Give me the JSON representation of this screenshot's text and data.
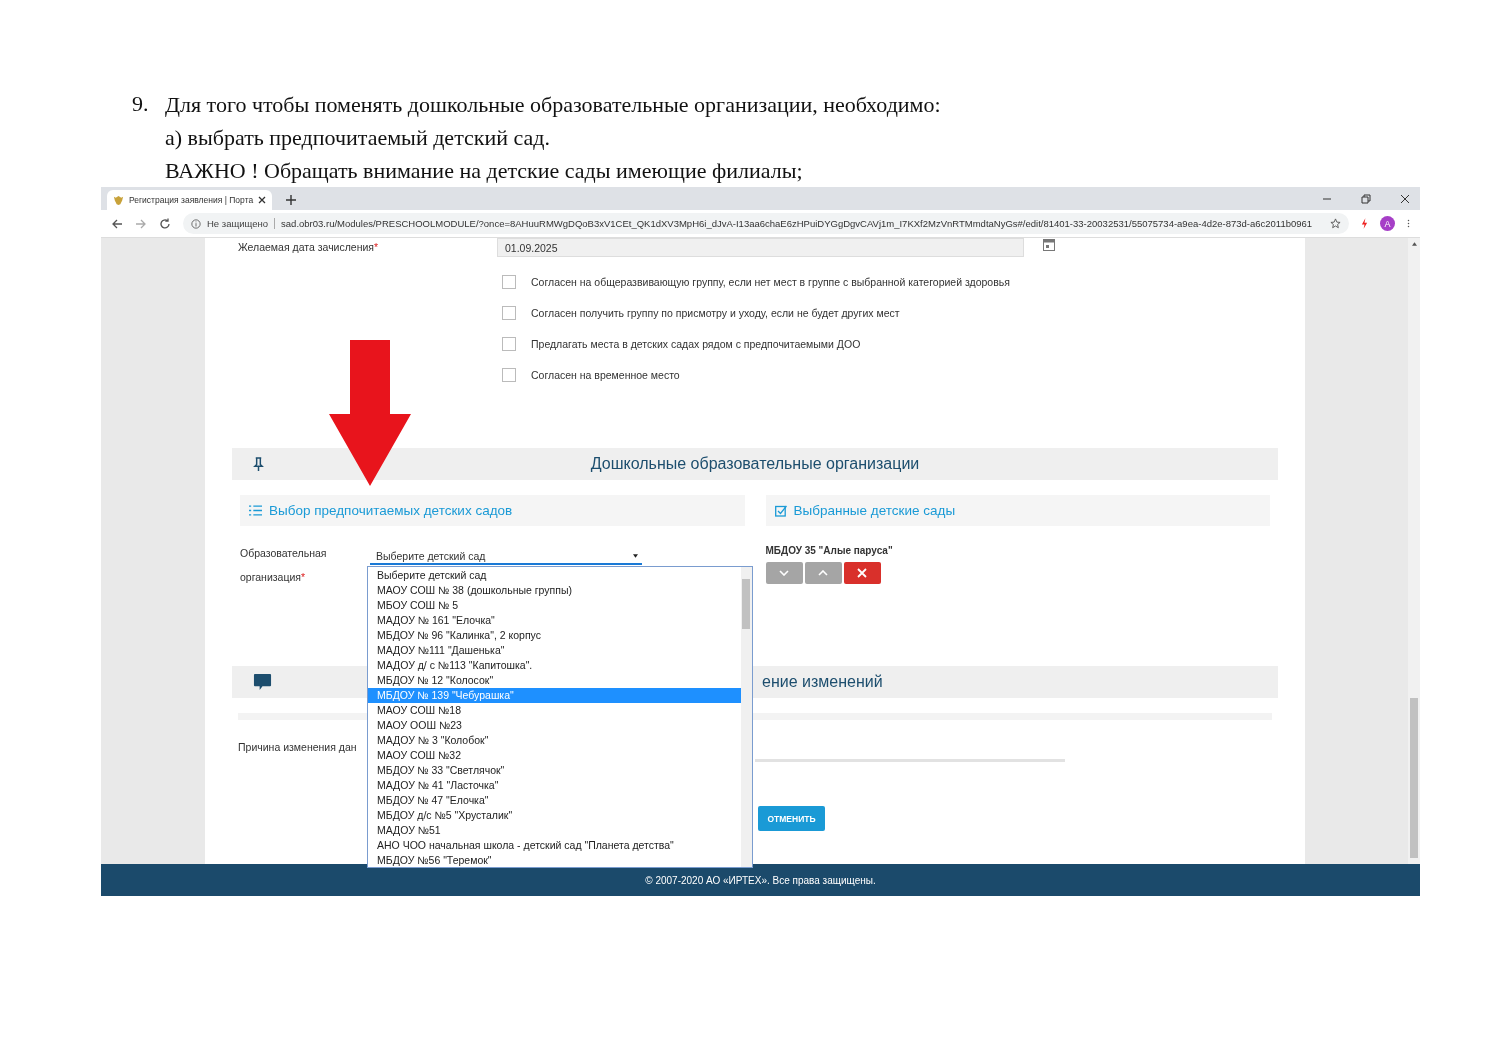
{
  "instructions": {
    "number": "9.",
    "lines": [
      "Для того чтобы поменять дошкольные образовательные организации, необходимо:",
      "а) выбрать предпочитаемый детский сад.",
      "ВАЖНО ! Обращать внимание на детские сады имеющие филиалы;"
    ]
  },
  "browser": {
    "tab_title": "Регистрация заявления | Порта",
    "security": "Не защищено",
    "url": "sad.obr03.ru/Modules/PRESCHOOLMODULE/?once=8AHuuRMWgDQoB3xV1CEt_QK1dXV3MpH6i_dJvA-I13aa6chaE6zHPuiDYGgDgvCAVj1m_I7KXf2MzVnRTMmdtaNyGs#/edit/81401-33-20032531/55075734-a9ea-4d2e-873d-a6c2011b0961",
    "profile_initial": "A"
  },
  "form": {
    "date_label": "Желаемая дата зачисления",
    "required_mark": "*",
    "date_value": "01.09.2025",
    "options": [
      {
        "label": "Согласен на общеразвивающую группу, если нет мест в группе с выбранной категорией здоровья",
        "checked": false
      },
      {
        "label": "Согласен получить группу по присмотру и уходу, если не будет других мест",
        "checked": false
      },
      {
        "label": "Предлагать места в детских садах рядом с предпочитаемыми ДОО",
        "checked": false
      },
      {
        "label": "Согласен на временное место",
        "checked": false
      }
    ]
  },
  "organizations_section": {
    "title": "Дошкольные образовательные организации",
    "choose_panel": {
      "title": "Выбор предпочитаемых детских садов",
      "field_label_lines": [
        "Образовательная",
        "организация"
      ],
      "required_mark": "*",
      "select_value": "Выберите детский сад",
      "dropdown_options": [
        {
          "label": "Выберите детский сад",
          "selected": false
        },
        {
          "label": "МАОУ СОШ № 38 (дошкольные группы)",
          "selected": false
        },
        {
          "label": "МБОУ СОШ № 5",
          "selected": false
        },
        {
          "label": "МАДОУ № 161 \"Елочка\"",
          "selected": false
        },
        {
          "label": "МБДОУ № 96 \"Калинка\", 2 корпус",
          "selected": false
        },
        {
          "label": "МАДОУ №111 \"Дашенька\"",
          "selected": false
        },
        {
          "label": "МАДОУ д/ с №113 \"Капитошка\".",
          "selected": false
        },
        {
          "label": "МБДОУ № 12 \"Колосок\"",
          "selected": false
        },
        {
          "label": "МБДОУ № 139 \"Чебурашка\"",
          "selected": true
        },
        {
          "label": "МАОУ СОШ №18",
          "selected": false
        },
        {
          "label": "МАОУ ООШ №23",
          "selected": false
        },
        {
          "label": "МАДОУ № 3 \"Колобок\"",
          "selected": false
        },
        {
          "label": "МАОУ СОШ №32",
          "selected": false
        },
        {
          "label": "МБДОУ № 33 \"Светлячок\"",
          "selected": false
        },
        {
          "label": "МАДОУ № 41 \"Ласточка\"",
          "selected": false
        },
        {
          "label": "МБДОУ № 47 \"Елочка\"",
          "selected": false
        },
        {
          "label": "МБДОУ д/с №5 \"Хрусталик\"",
          "selected": false
        },
        {
          "label": "МАДОУ №51",
          "selected": false
        },
        {
          "label": "АНО ЧОО начальная школа - детский сад \"Планета детства\"",
          "selected": false
        },
        {
          "label": "МБДОУ №56 \"Теремок\"",
          "selected": false
        }
      ]
    },
    "selected_panel": {
      "title": "Выбранные детские сады",
      "items": [
        "МБДОУ 35 \"Алые паруса\""
      ]
    }
  },
  "changes_section": {
    "title": "ение изменений",
    "reason_label": "Причина изменения дан",
    "cancel_button": "ОТМЕНИТЬ"
  },
  "footer": "© 2007-2020 АО «ИРТЕХ». Все права защищены."
}
